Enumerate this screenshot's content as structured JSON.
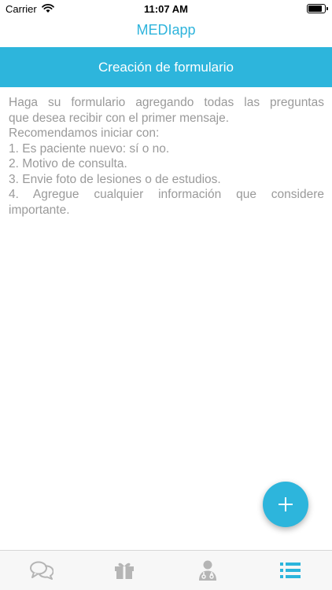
{
  "status_bar": {
    "carrier": "Carrier",
    "time": "11:07 AM"
  },
  "app_title": "MEDIapp",
  "banner_title": "Creación de formulario",
  "instructions": [
    "Haga su formulario agregando todas las preguntas",
    "que desea recibir con el primer mensaje.",
    "Recomendamos iniciar con:",
    "1. Es paciente nuevo: sí o no.",
    "2. Motivo de consulta.",
    "3. Envie foto de lesiones o de estudios.",
    "4. Agregue cualquier información que considere",
    "importante."
  ],
  "colors": {
    "accent": "#2db5dc",
    "text_muted": "#9a9a9a",
    "tab_inactive": "#b5b5b5"
  },
  "fab_icon": "plus-icon",
  "tabs": [
    {
      "icon": "chat-bubbles-icon",
      "active": false
    },
    {
      "icon": "gift-icon",
      "active": false
    },
    {
      "icon": "doctor-icon",
      "active": false
    },
    {
      "icon": "list-icon",
      "active": true
    }
  ]
}
